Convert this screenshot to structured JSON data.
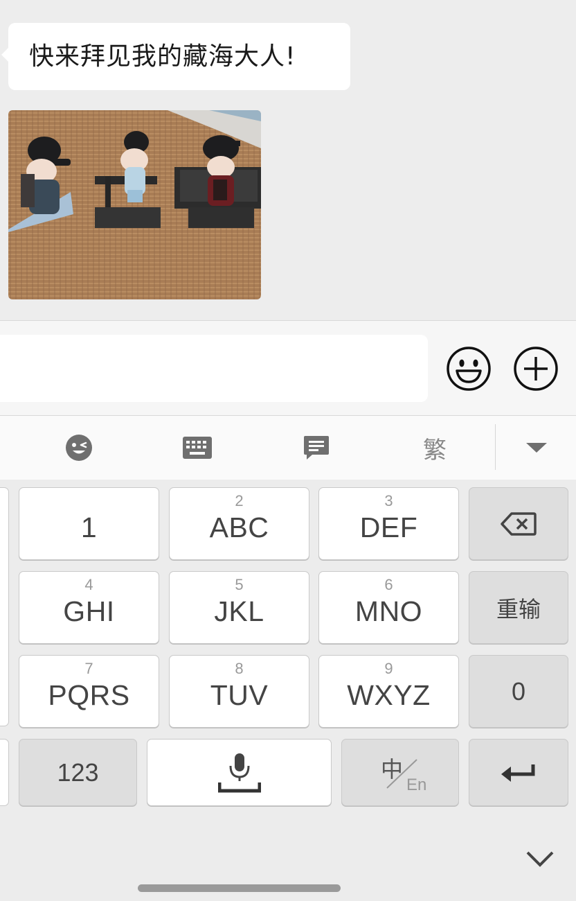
{
  "chat": {
    "message_text": "快来拜见我的藏海大人!",
    "bubble_color": "#ffffff",
    "background_color": "#ededed"
  },
  "input_bar": {
    "text_value": "",
    "emoji_icon": "smiley-face-icon",
    "plus_icon": "plus-circle-icon"
  },
  "keyboard_toolbar": {
    "items": [
      {
        "icon": "emoji-wink-icon"
      },
      {
        "icon": "keyboard-icon"
      },
      {
        "icon": "chat-phrase-icon"
      },
      {
        "label": "繁"
      },
      {
        "icon": "triangle-down-icon"
      }
    ]
  },
  "keyboard": {
    "rows": [
      [
        {
          "num": "",
          "label": "1"
        },
        {
          "num": "2",
          "label": "ABC"
        },
        {
          "num": "3",
          "label": "DEF"
        },
        {
          "icon": "backspace-icon"
        }
      ],
      [
        {
          "num": "4",
          "label": "GHI"
        },
        {
          "num": "5",
          "label": "JKL"
        },
        {
          "num": "6",
          "label": "MNO"
        },
        {
          "label": "重输"
        }
      ],
      [
        {
          "num": "7",
          "label": "PQRS"
        },
        {
          "num": "8",
          "label": "TUV"
        },
        {
          "num": "9",
          "label": "WXYZ"
        },
        {
          "label": "0"
        }
      ]
    ],
    "bottom": {
      "numbers_label": "123",
      "space_icon": "microphone-space-icon",
      "lang_zh": "中",
      "lang_en": "En",
      "enter_icon": "return-arrow-icon"
    },
    "collapse_icon": "chevron-down-icon"
  }
}
